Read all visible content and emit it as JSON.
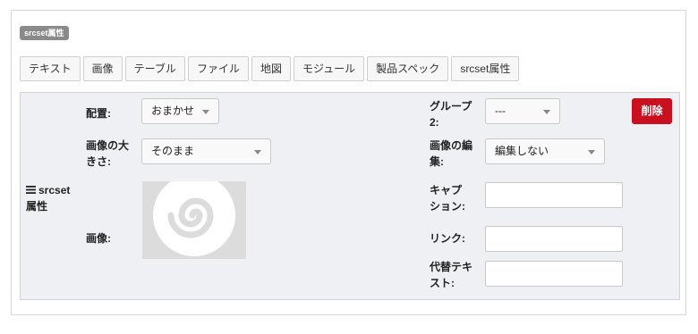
{
  "badge": "srcset属性",
  "tabs": [
    "テキスト",
    "画像",
    "テーブル",
    "ファイル",
    "地図",
    "モジュール",
    "製品スペック",
    "srcset属性"
  ],
  "block": {
    "handle_label_line1": "srcset",
    "handle_label_line2": "属性",
    "placement": {
      "label": "配置:",
      "value": "おまかせ"
    },
    "size": {
      "label_line1": "画像の大",
      "label_line2": "きさ:",
      "value": "そのまま"
    },
    "image": {
      "label": "画像:"
    },
    "group": {
      "label_line1": "グループ",
      "label_line2": "2:",
      "value": "---"
    },
    "edit": {
      "label_line1": "画像の編",
      "label_line2": "集:",
      "value": "編集しない"
    },
    "caption": {
      "label_line1": "キャプ",
      "label_line2": "ション:",
      "value": ""
    },
    "link": {
      "label": "リンク:",
      "value": ""
    },
    "alt": {
      "label_line1": "代替テキ",
      "label_line2": "スト:",
      "value": ""
    },
    "delete_label": "削除"
  },
  "colors": {
    "delete": "#c8101f",
    "badge": "#8a8a8a",
    "panel": "#eef0f4"
  },
  "icons": [
    "hamburger-icon",
    "image-placeholder-icon",
    "caret-down-icon"
  ]
}
